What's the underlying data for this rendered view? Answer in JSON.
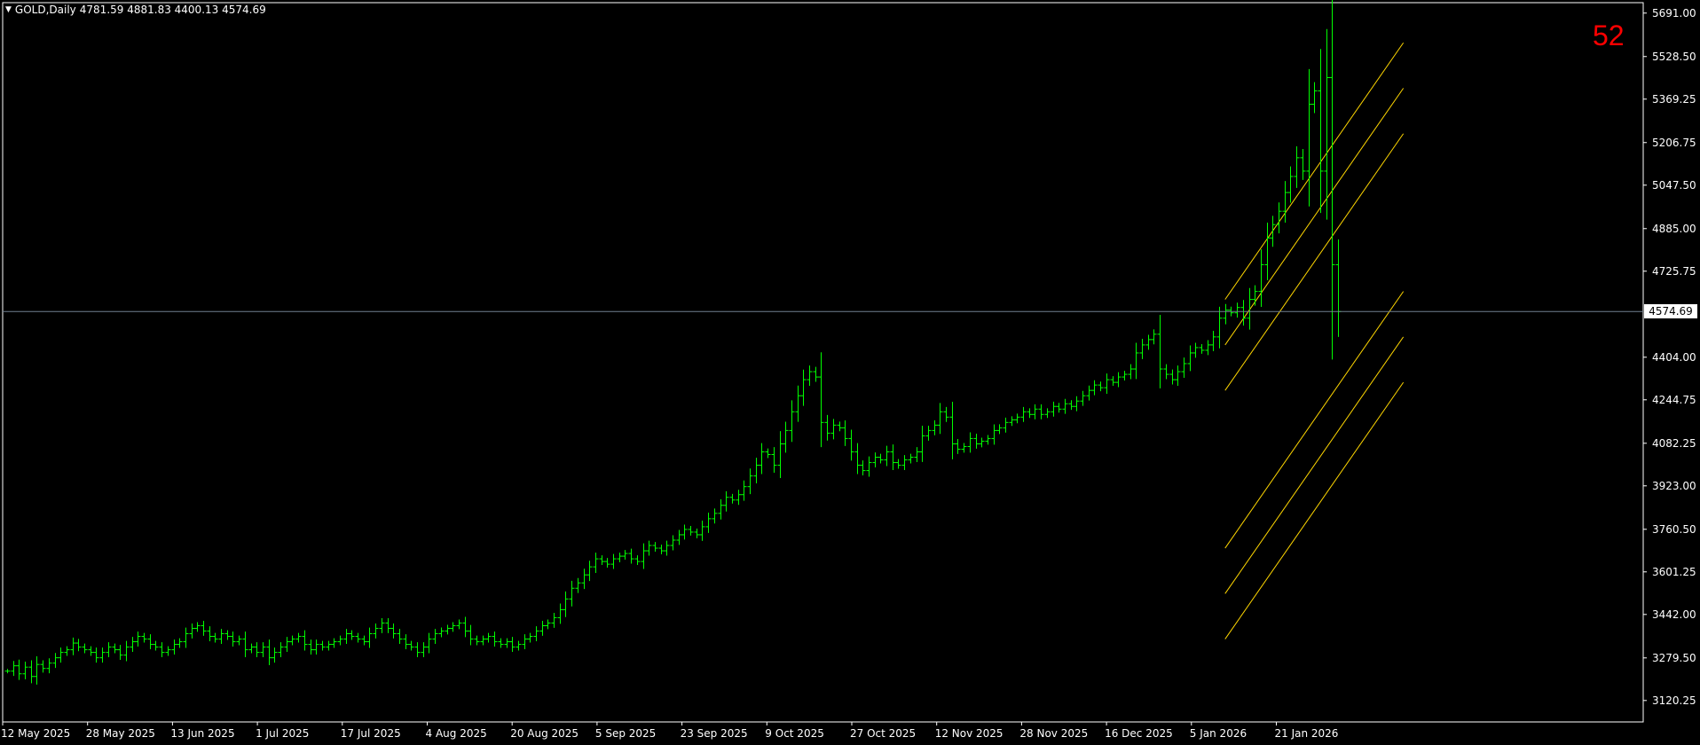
{
  "header": {
    "arrow": "▼",
    "symbol": "GOLD,Daily",
    "ohlc": "4781.59 4881.83 4400.13 4574.69"
  },
  "counter": "52",
  "current_price_label": "4574.69",
  "colors": {
    "background": "#000000",
    "candle": "#00ff00",
    "channel": "#ffd700",
    "price_line": "#708090",
    "axis": "#ffffff",
    "counter": "#ff0000"
  },
  "chart_data": {
    "type": "line",
    "title": "",
    "xlabel": "",
    "ylabel": "",
    "ylim": [
      3040,
      5730
    ],
    "y_ticks": [
      "5691.00",
      "5528.50",
      "5369.25",
      "5206.75",
      "5047.50",
      "4885.00",
      "4725.75",
      "4404.00",
      "4244.75",
      "4082.25",
      "3923.00",
      "3760.50",
      "3601.25",
      "3442.00",
      "3279.50",
      "3120.25"
    ],
    "x_ticks": [
      "12 May 2025",
      "28 May 2025",
      "13 Jun 2025",
      "1 Jul 2025",
      "17 Jul 2025",
      "4 Aug 2025",
      "20 Aug 2025",
      "5 Sep 2025",
      "23 Sep 2025",
      "9 Oct 2025",
      "27 Oct 2025",
      "12 Nov 2025",
      "28 Nov 2025",
      "16 Dec 2025",
      "5 Jan 2026",
      "21 Jan 2026"
    ],
    "current_price": 4574.69,
    "closes": [
      3230,
      3250,
      3220,
      3245,
      3210,
      3255,
      3240,
      3260,
      3280,
      3300,
      3310,
      3335,
      3320,
      3310,
      3300,
      3280,
      3300,
      3320,
      3310,
      3290,
      3320,
      3340,
      3360,
      3350,
      3330,
      3320,
      3300,
      3310,
      3330,
      3340,
      3370,
      3390,
      3400,
      3380,
      3360,
      3350,
      3370,
      3360,
      3340,
      3350,
      3310,
      3320,
      3300,
      3320,
      3280,
      3300,
      3320,
      3340,
      3350,
      3360,
      3330,
      3310,
      3330,
      3320,
      3330,
      3340,
      3350,
      3370,
      3360,
      3350,
      3340,
      3370,
      3390,
      3410,
      3390,
      3370,
      3350,
      3330,
      3320,
      3300,
      3320,
      3350,
      3370,
      3380,
      3390,
      3400,
      3410,
      3380,
      3350,
      3340,
      3350,
      3360,
      3340,
      3330,
      3340,
      3320,
      3330,
      3350,
      3360,
      3380,
      3400,
      3410,
      3430,
      3460,
      3500,
      3540,
      3560,
      3590,
      3620,
      3650,
      3640,
      3630,
      3650,
      3660,
      3670,
      3650,
      3640,
      3680,
      3700,
      3690,
      3680,
      3700,
      3720,
      3740,
      3760,
      3750,
      3740,
      3770,
      3800,
      3820,
      3850,
      3880,
      3870,
      3890,
      3920,
      3960,
      4000,
      4050,
      4040,
      4000,
      4080,
      4130,
      4200,
      4260,
      4320,
      4350,
      4330,
      4160,
      4120,
      4150,
      4140,
      4100,
      4050,
      4000,
      3980,
      4010,
      4030,
      4020,
      4050,
      4010,
      4000,
      4020,
      4030,
      4050,
      4110,
      4130,
      4150,
      4200,
      4180,
      4080,
      4060,
      4070,
      4100,
      4080,
      4090,
      4100,
      4130,
      4140,
      4160,
      4170,
      4180,
      4200,
      4190,
      4210,
      4190,
      4200,
      4220,
      4210,
      4230,
      4220,
      4240,
      4260,
      4280,
      4300,
      4290,
      4320,
      4310,
      4330,
      4340,
      4360,
      4420,
      4450,
      4470,
      4490,
      4360,
      4340,
      4320,
      4350,
      4380,
      4420,
      4440,
      4430,
      4450,
      4480,
      4550,
      4580,
      4570,
      4590,
      4550,
      4620,
      4650,
      4750,
      4850,
      4900,
      4950,
      5020,
      5080,
      5150,
      5100,
      5350,
      5400,
      5100,
      5450,
      4750,
      4574.69
    ],
    "channel_lines": [
      {
        "start": [
          205,
          4620
        ],
        "end": [
          235,
          5580
        ]
      },
      {
        "start": [
          205,
          4450
        ],
        "end": [
          235,
          5410
        ]
      },
      {
        "start": [
          205,
          4280
        ],
        "end": [
          235,
          5240
        ]
      },
      {
        "start": [
          205,
          3690
        ],
        "end": [
          235,
          4650
        ]
      },
      {
        "start": [
          205,
          3520
        ],
        "end": [
          235,
          4480
        ]
      },
      {
        "start": [
          205,
          3350
        ],
        "end": [
          235,
          4310
        ]
      }
    ]
  }
}
